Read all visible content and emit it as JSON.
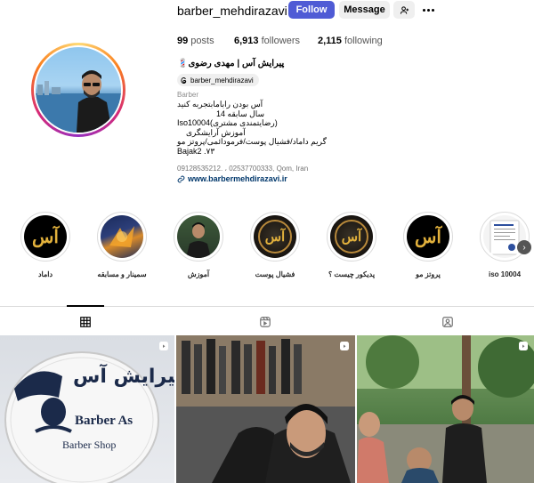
{
  "header": {
    "username": "barber_mehdirazavi",
    "follow_label": "Follow",
    "message_label": "Message",
    "add_user_icon": "person-add-icon",
    "more_icon": "more-horizontal-icon"
  },
  "stats": {
    "posts_count": "99",
    "posts_label": " posts",
    "followers_count": "6,913",
    "followers_label": " followers",
    "following_count": "2,115",
    "following_label": " following"
  },
  "bio": {
    "display_name": "پیرایش آس | مهدی رضوی💈",
    "threads_handle": "barber_mehdirazavi",
    "category": "Barber",
    "lines": [
      "آس بودن رابامابتجربه کنید",
      "14 سال سابقه",
      "Iso10004(رضایتمندی مشتری)",
      "آموزش آرایشگری",
      "گریم داماد/فشیال پوست/فرمودائمی/پروتز مو",
      "Bajak2 .۷۳"
    ],
    "address": "09128535212. ، 02537700333, Qom, Iran",
    "link": "www.barbermehdirazavi.ir"
  },
  "highlights": [
    {
      "label": "داماد",
      "icon": "barber-logo-icon"
    },
    {
      "label": "سمینار و مسابقه",
      "icon": "seminar-poster-icon"
    },
    {
      "label": "آموزش",
      "icon": "training-photo-icon"
    },
    {
      "label": "فشیال پوست",
      "icon": "gold-logo-icon"
    },
    {
      "label": "پدیکور چیست ؟",
      "icon": "gold-logo-icon"
    },
    {
      "label": "پروتز مو",
      "icon": "barber-logo-icon"
    },
    {
      "label": "iso 10004",
      "icon": "certificate-icon"
    }
  ],
  "highlight_logo_text": "آس",
  "tabs": {
    "posts_icon": "grid-icon",
    "reels_icon": "reels-icon",
    "tagged_icon": "tagged-icon"
  },
  "posts": [
    {
      "sign_title": "پیرایش آس",
      "sign_line1": "Barber As",
      "sign_line2": "Barber Shop",
      "icon": "reel-icon"
    },
    {
      "icon": "reel-icon"
    },
    {
      "icon": "reel-icon"
    }
  ],
  "colors": {
    "follow_button": "#4f5bd5",
    "link": "#00376b",
    "logo_gold": "#e2b13c"
  }
}
